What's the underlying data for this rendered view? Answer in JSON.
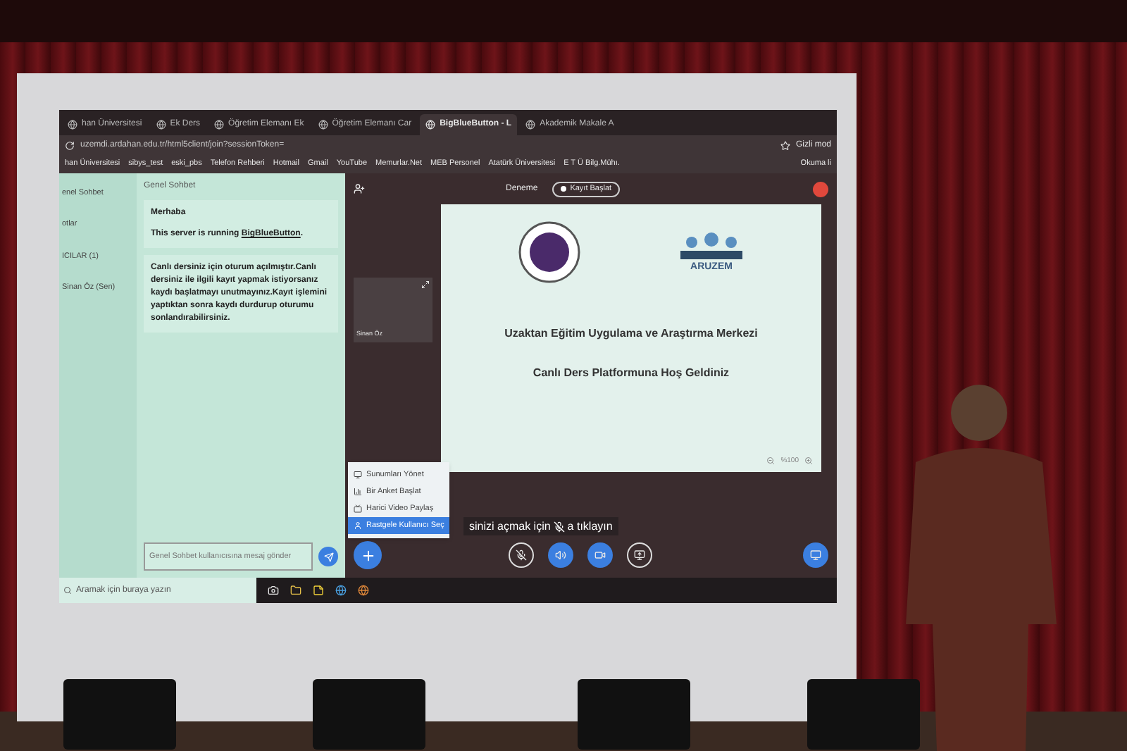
{
  "browser": {
    "tabs": [
      {
        "label": "han Üniversitesi",
        "selected": false
      },
      {
        "label": "Ek Ders",
        "selected": false
      },
      {
        "label": "Öğretim Elemanı Ek",
        "selected": false
      },
      {
        "label": "Öğretim Elemanı Car",
        "selected": false
      },
      {
        "label": "BigBlueButton - L",
        "selected": true
      },
      {
        "label": "Akademik Makale A",
        "selected": false
      }
    ],
    "address": "uzemdi.ardahan.edu.tr/html5client/join?sessionToken=",
    "bookmarks": [
      "han Üniversitesi",
      "sibys_test",
      "eski_pbs",
      "Telefon Rehberi",
      "Hotmail",
      "Gmail",
      "YouTube",
      "Memurlar.Net",
      "MEB Personel",
      "Atatürk Üniversitesi",
      "E T Ü Bilg.Mühı."
    ],
    "reading_list": "Okuma li",
    "profile": "Gizli mod"
  },
  "users_panel": {
    "items": [
      "enel Sohbet",
      "otlar",
      "ICILAR (1)",
      "Sinan Öz (Sen)"
    ]
  },
  "chat": {
    "title": "Genel Sohbet",
    "greeting": "Merhaba",
    "server_text": "This server is running ",
    "server_link": "BigBlueButton",
    "server_after": ".",
    "message": "Canlı dersiniz için oturum açılmıştır.Canlı dersiniz ile ilgili kayıt yapmak istiyorsanız kaydı başlatmayı unutmayınız.Kayıt işlemini yaptıktan sonra kaydı durdurup oturumu sonlandırabilirsiniz.",
    "placeholder": "Genel Sohbet kullanıcısına mesaj gönder"
  },
  "meeting": {
    "title": "Deneme",
    "record_button": "Kayıt Başlat"
  },
  "video": {
    "name": "Sinan Öz"
  },
  "slide": {
    "logo_text": "ARUZEM",
    "heading": "Uzaktan Eğitim Uygulama ve Araştırma Merkezi",
    "subheading": "Canlı Ders Platformuna Hoş Geldiniz",
    "zoom": "%100"
  },
  "menu": [
    {
      "label": "Sunumları Yönet",
      "selected": false
    },
    {
      "label": "Bir Anket Başlat",
      "selected": false
    },
    {
      "label": "Harici Video Paylaş",
      "selected": false
    },
    {
      "label": "Rastgele Kullanıcı Seç",
      "selected": true
    }
  ],
  "tooltip": {
    "before": "sinizi açmak için",
    "after": "a tıklayın"
  },
  "taskbar": {
    "search_placeholder": "Aramak için buraya yazın"
  }
}
